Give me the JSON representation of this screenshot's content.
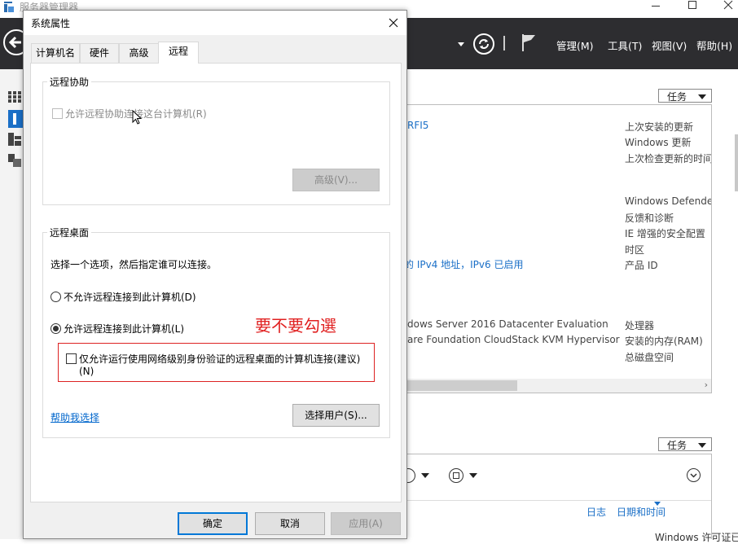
{
  "server_manager": {
    "title": "服务器管理器",
    "menu": [
      "管理(M)",
      "工具(T)",
      "视图(V)",
      "帮助(H)"
    ],
    "tasks_label": "任务",
    "properties_left": [
      "RFI5",
      "的 IPv4 地址，IPv6 已启用",
      "dows Server 2016 Datacenter Evaluation",
      "are Foundation CloudStack KVM Hypervisor"
    ],
    "properties_right": [
      "上次安装的更新",
      "Windows 更新",
      "上次检查更新的时间",
      "Windows Defende",
      "反馈和诊断",
      "IE 增强的安全配置",
      "时区",
      "产品 ID",
      "处理器",
      "安装的内存(RAM)",
      "总磁盘空间"
    ],
    "events_columns": [
      "日志",
      "日期和时间"
    ],
    "watermark": "Windows 许可证已"
  },
  "dialog": {
    "title": "系统属性",
    "tabs": [
      "计算机名",
      "硬件",
      "高级",
      "远程"
    ],
    "remote_assistance": {
      "group_label": "远程协助",
      "allow_checkbox": "允许远程协助连接这台计算机(R)",
      "advanced_button": "高级(V)..."
    },
    "remote_desktop": {
      "group_label": "远程桌面",
      "instruction": "选择一个选项，然后指定谁可以连接。",
      "option_deny": "不允许远程连接到此计算机(D)",
      "option_allow": "允许远程连接到此计算机(L)",
      "nla_checkbox_line1": "仅允许运行使用网络级别身份验证的远程桌面的计算机连接(建议)",
      "nla_checkbox_line2": "(N)",
      "help_link": "帮助我选择",
      "select_users_button": "选择用户(S)..."
    },
    "annotation": "要不要勾選",
    "buttons": {
      "ok": "确定",
      "cancel": "取消",
      "apply": "应用(A)"
    }
  }
}
